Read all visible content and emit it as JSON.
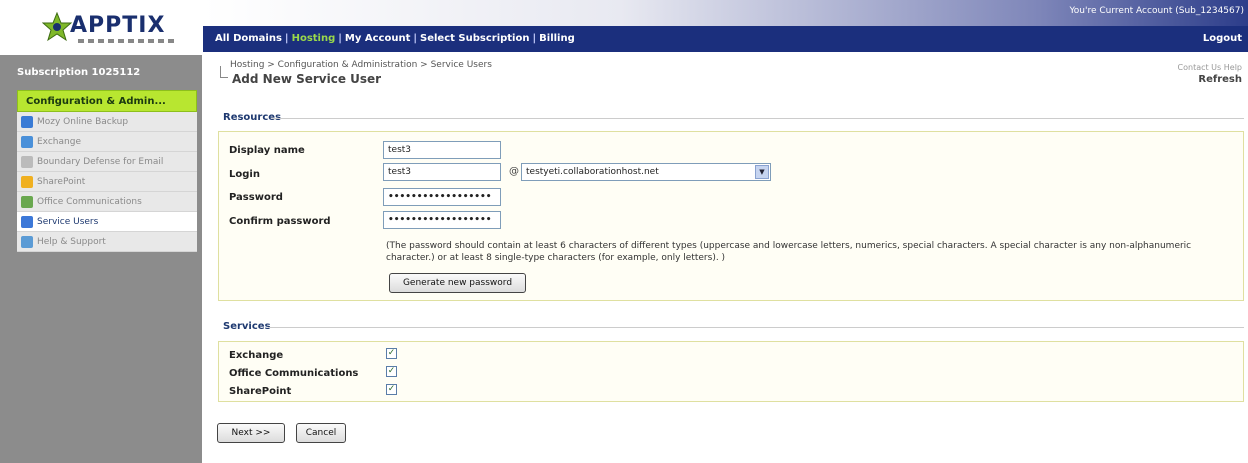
{
  "logo": {
    "text": "APPTIX"
  },
  "top_bar": {
    "user_info": "You're Current Account (Sub_1234567)",
    "nav_items": [
      {
        "label": "All Domains",
        "active": false
      },
      {
        "label": "Hosting",
        "active": true
      },
      {
        "label": "My Account",
        "active": false
      },
      {
        "label": "Select Subscription",
        "active": false
      },
      {
        "label": "Billing",
        "active": false
      }
    ],
    "separator": "|",
    "logout": "Logout"
  },
  "sidebar": {
    "subscription_header": "Subscription 1025112",
    "section": "Configuration & Admin...",
    "items": [
      {
        "label": "Mozy Online Backup",
        "icon": "backup-icon",
        "color": "#3a7bd5",
        "active": false
      },
      {
        "label": "Exchange",
        "icon": "exchange-icon",
        "color": "#4a90d9",
        "active": false
      },
      {
        "label": "Boundary Defense for Email",
        "icon": "shield-icon",
        "color": "#bbbbbb",
        "active": false
      },
      {
        "label": "SharePoint",
        "icon": "sharepoint-icon",
        "color": "#f0b020",
        "active": false
      },
      {
        "label": "Office Communications",
        "icon": "communications-icon",
        "color": "#6aa84f",
        "active": false
      },
      {
        "label": "Service Users",
        "icon": "users-icon",
        "color": "#3c78d8",
        "active": true
      },
      {
        "label": "Help & Support",
        "icon": "help-icon",
        "color": "#5b9bd5",
        "active": false
      }
    ]
  },
  "page": {
    "breadcrumb": "Hosting  >  Configuration & Administration  >  Service Users",
    "title": "Add New Service User",
    "right_link": "Contact Us  Help",
    "refresh": "Refresh"
  },
  "resources": {
    "heading": "Resources",
    "display_name_label": "Display name",
    "display_name_value": "test3",
    "login_label": "Login",
    "login_value": "test3",
    "at_sign": "@",
    "domain_value": "testyeti.collaborationhost.net",
    "password_label": "Password",
    "password_value": "••••••••••••••••••",
    "confirm_label": "Confirm password",
    "confirm_value": "••••••••••••••••••",
    "note": "(The password should contain at least 6 characters of different types (uppercase and lowercase letters, numerics, special characters. A special character is any non-alphanumeric character.) or at least 8 single-type characters (for example, only letters). )",
    "generate_button": "Generate new password"
  },
  "services": {
    "heading": "Services",
    "items": [
      {
        "label": "Exchange",
        "checked": true
      },
      {
        "label": "Office Communications",
        "checked": true
      },
      {
        "label": "SharePoint",
        "checked": true
      }
    ]
  },
  "actions": {
    "next": "Next >>",
    "cancel": "Cancel"
  },
  "colors": {
    "nav_bar": "#1b2f7d",
    "active_nav": "#9ad94a",
    "sidebar_section": "#b8e630",
    "sidebar_bg": "#8c8c8c"
  }
}
